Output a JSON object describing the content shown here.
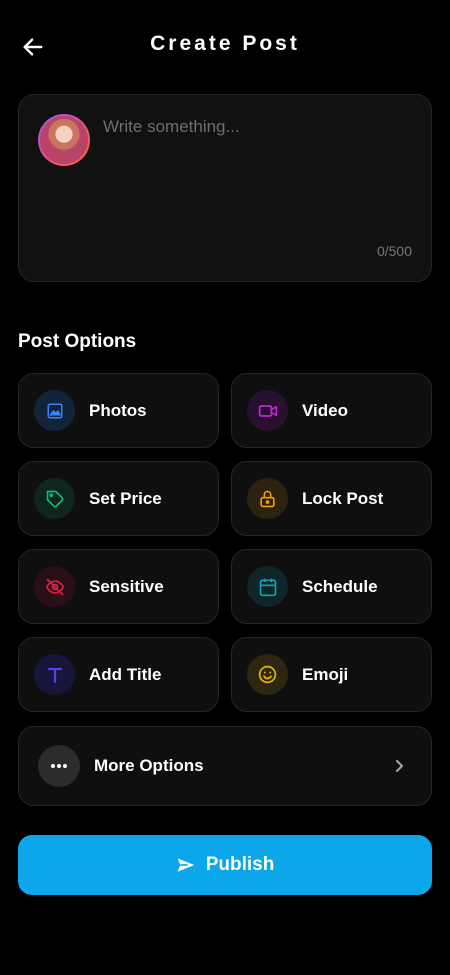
{
  "header": {
    "title": "Create Post",
    "back_icon": "arrow-left-icon"
  },
  "composer": {
    "avatar_icon": "user-avatar",
    "placeholder": "Write something...",
    "value": "",
    "counter": "0/500"
  },
  "post_options": {
    "section_label": "Post Options",
    "items": [
      {
        "label": "Photos",
        "icon": "image-icon",
        "color": "#3b82f6"
      },
      {
        "label": "Video",
        "icon": "video-icon",
        "color": "#c026d3"
      },
      {
        "label": "Set Price",
        "icon": "tag-icon",
        "color": "#10b981"
      },
      {
        "label": "Lock Post",
        "icon": "lock-icon",
        "color": "#f59e0b"
      },
      {
        "label": "Sensitive",
        "icon": "eye-off-icon",
        "color": "#e11d48"
      },
      {
        "label": "Schedule",
        "icon": "calendar-icon",
        "color": "#0ea5b7"
      },
      {
        "label": "Add Title",
        "icon": "title-t-icon",
        "color": "#4f46e5"
      },
      {
        "label": "Emoji",
        "icon": "smiley-icon",
        "color": "#eab308"
      }
    ],
    "more": {
      "label": "More Options",
      "icon": "more-dots-icon"
    }
  },
  "publish": {
    "label": "Publish",
    "icon": "send-icon",
    "color": "#0ba7ea"
  }
}
